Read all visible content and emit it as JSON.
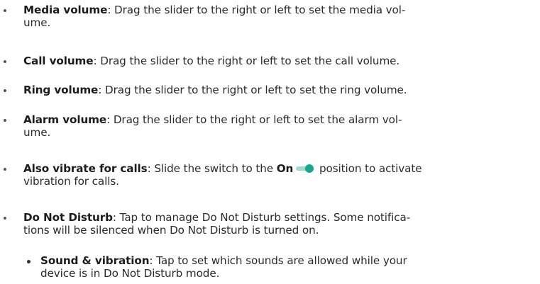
{
  "items": [
    {
      "term": "Media volume",
      "rest": ": Drag the slider to the right or left to set the media vol-",
      "rest2": "ume."
    },
    {
      "term": "Call volume",
      "rest": ": Drag the slider to the right or left to set the call volume."
    },
    {
      "term": "Ring volume",
      "rest": ": Drag the slider to the right or left to set the ring volume."
    },
    {
      "term": "Alarm volume",
      "rest": ": Drag the slider to the right or left to set the alarm vol-",
      "rest2": "ume."
    },
    {
      "term": "Also vibrate for calls",
      "rest_a": ": Slide the switch to the ",
      "on_label": "On",
      "rest_b": " position to activate",
      "rest2": "vibration for calls."
    },
    {
      "term": "Do Not Disturb",
      "rest": ": Tap to manage Do Not Disturb settings. Some notifica-",
      "rest2": "tions will be silenced when Do Not Disturb is turned on."
    }
  ],
  "sub_items": [
    {
      "term": "Sound & vibration",
      "rest": ": Tap to set which sounds are allowed while your",
      "rest2": "device is in Do Not Disturb mode."
    }
  ],
  "colors": {
    "toggle_knob": "#1aa792",
    "toggle_track": "#9fd8cf",
    "text": "#2b2b2b"
  },
  "icons": {
    "toggle": "toggle-on-icon"
  }
}
